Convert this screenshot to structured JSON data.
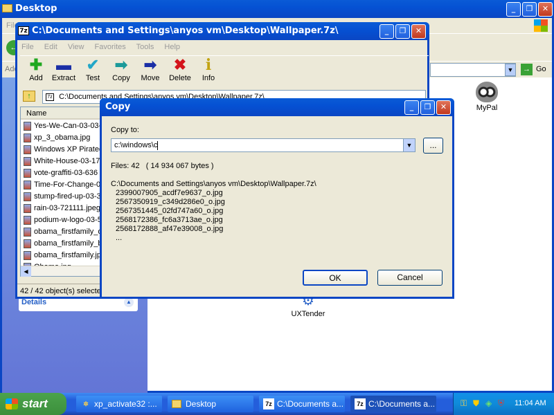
{
  "desktop_window": {
    "title": "Desktop",
    "menu_partial": "File",
    "address_label": "Address",
    "go_label": "Go",
    "details_label": "Details"
  },
  "desktop_icons": [
    {
      "label": "MyPal",
      "icon": "raccoon-icon"
    },
    {
      "label": "UXTender",
      "icon": "gear-icon"
    }
  ],
  "sevenzip": {
    "logo": "7z",
    "title": "C:\\Documents and Settings\\anyos vm\\Desktop\\Wallpaper.7z\\",
    "menu": [
      "File",
      "Edit",
      "View",
      "Favorites",
      "Tools",
      "Help"
    ],
    "toolbar": [
      {
        "label": "Add",
        "icon": "plus-icon",
        "color": "#1fa81f"
      },
      {
        "label": "Extract",
        "icon": "minus-icon",
        "color": "#1a2fa6"
      },
      {
        "label": "Test",
        "icon": "check-icon",
        "color": "#22a7c7"
      },
      {
        "label": "Copy",
        "icon": "copy-arrow-icon",
        "color": "#1b9a9a"
      },
      {
        "label": "Move",
        "icon": "move-arrow-icon",
        "color": "#1a2fa6"
      },
      {
        "label": "Delete",
        "icon": "x-icon",
        "color": "#d4141b"
      },
      {
        "label": "Info",
        "icon": "info-icon",
        "color": "#c2a312"
      }
    ],
    "path": "C:\\Documents and Settings\\anyos vm\\Desktop\\Wallpaper.7z\\",
    "column_name": "Name",
    "files": [
      "Yes-We-Can-03-03-",
      "xp_3_obama.jpg",
      "Windows XP Pirated",
      "White-House-03-17",
      "vote-graffiti-03-636",
      "Time-For-Change-0",
      "stump-fired-up-03-3",
      "rain-03-721111.jpeg",
      "podium-w-logo-03-5",
      "obama_firstfamily_o",
      "obama_firstfamily_b",
      "obama_firstfamily.jp",
      "Obama.jpg"
    ],
    "status": "42 / 42 object(s) selected"
  },
  "copy_dialog": {
    "title": "Copy",
    "copy_to_label": "Copy to:",
    "destination_value": "c:\\windows\\c",
    "browse_label": "...",
    "files_info": "Files: 42   ( 14 934 067 bytes )",
    "source_path": "C:\\Documents and Settings\\anyos vm\\Desktop\\Wallpaper.7z\\",
    "file_list": [
      "2399007905_acdf7e9637_o.jpg",
      "2567350919_c349d286e0_o.jpg",
      "2567351445_02fd747a60_o.jpg",
      "2568172386_fc6a3713ae_o.jpg",
      "2568172888_af47e39008_o.jpg",
      "..."
    ],
    "ok_label": "OK",
    "cancel_label": "Cancel"
  },
  "taskbar": {
    "start_label": "start",
    "items": [
      {
        "label": "xp_activate32 :...",
        "icon": "activate-icon"
      },
      {
        "label": "Desktop",
        "icon": "folder-icon"
      },
      {
        "label": "C:\\Documents a...",
        "icon": "7z-icon"
      },
      {
        "label": "C:\\Documents a...",
        "icon": "7z-icon"
      }
    ],
    "clock": "11:04 AM"
  }
}
